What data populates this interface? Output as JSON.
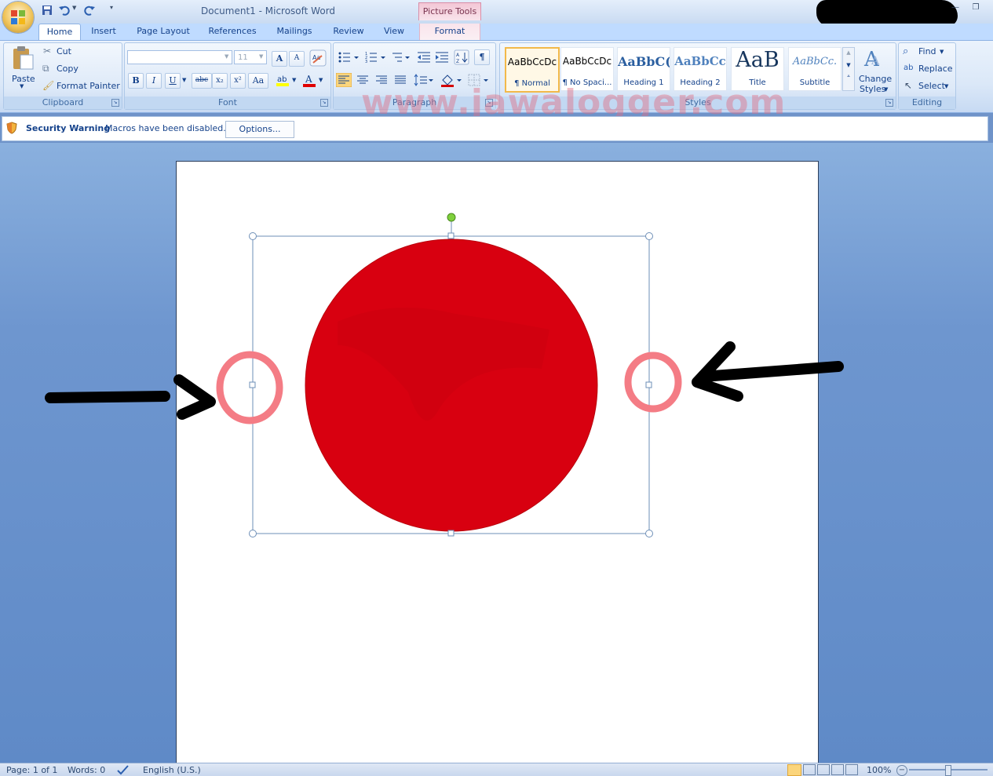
{
  "window": {
    "title": "Document1 - Microsoft Word",
    "contextual_tab": "Picture Tools"
  },
  "tabs": [
    "Home",
    "Insert",
    "Page Layout",
    "References",
    "Mailings",
    "Review",
    "View",
    "Format"
  ],
  "clipboard": {
    "paste": "Paste",
    "cut": "Cut",
    "copy": "Copy",
    "format_painter": "Format Painter",
    "label": "Clipboard"
  },
  "font": {
    "size": "11",
    "bold": "B",
    "italic": "I",
    "underline": "U",
    "strike": "abc",
    "subscript": "x₂",
    "superscript": "x²",
    "change_case": "Aa",
    "grow": "A",
    "shrink": "A",
    "label": "Font"
  },
  "paragraph": {
    "show_marks": "¶",
    "label": "Paragraph"
  },
  "styles": {
    "items": [
      {
        "sample": "AaBbCcDc",
        "name": "¶ Normal"
      },
      {
        "sample": "AaBbCcDc",
        "name": "¶ No Spaci..."
      },
      {
        "sample": "AaBbC(",
        "name": "Heading 1"
      },
      {
        "sample": "AaBbCc",
        "name": "Heading 2"
      },
      {
        "sample": "AaB",
        "name": "Title"
      },
      {
        "sample": "AaBbCc.",
        "name": "Subtitle"
      }
    ],
    "change_styles_line1": "Change",
    "change_styles_line2": "Styles",
    "label": "Styles"
  },
  "editing": {
    "find": "Find",
    "replace": "Replace",
    "select": "Select",
    "label": "Editing"
  },
  "security": {
    "title": "Security Warning",
    "message": "Macros have been disabled.",
    "options": "Options..."
  },
  "watermark": "www.jawalogger.com",
  "status": {
    "page": "Page: 1 of 1",
    "words": "Words: 0",
    "language": "English (U.S.)",
    "zoom": "100%"
  },
  "colors": {
    "circle": "#d80010",
    "annotation_ring": "#f47c85",
    "selection_border": "#6e8fb7",
    "rotate_handle": "#7fd03c"
  }
}
